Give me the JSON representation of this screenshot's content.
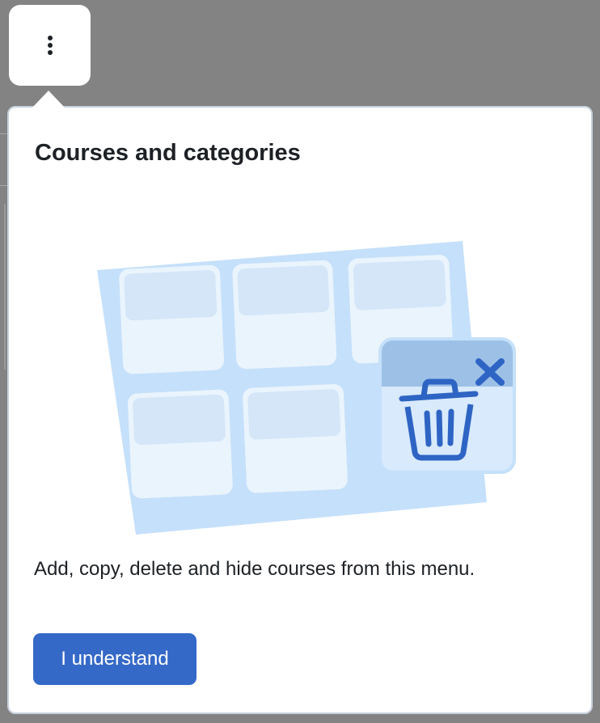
{
  "trigger": {
    "icon": "kebab-menu-icon"
  },
  "popover": {
    "title": "Courses and categories",
    "description": "Add, copy, delete and hide courses from this menu.",
    "button_label": "I understand",
    "illustration_icons": [
      "course-grid-icon",
      "trash-icon",
      "close-icon"
    ]
  },
  "colors": {
    "backdrop": "#838383",
    "primary": "#3569c8",
    "text": "#1d2125",
    "illustration_light": "#c5e0fa",
    "illustration_card": "#eaf4fd",
    "illustration_card_header": "#d4e6f8",
    "trash_panel": "#9dc1e6",
    "trash_blue": "#2e64c4"
  }
}
